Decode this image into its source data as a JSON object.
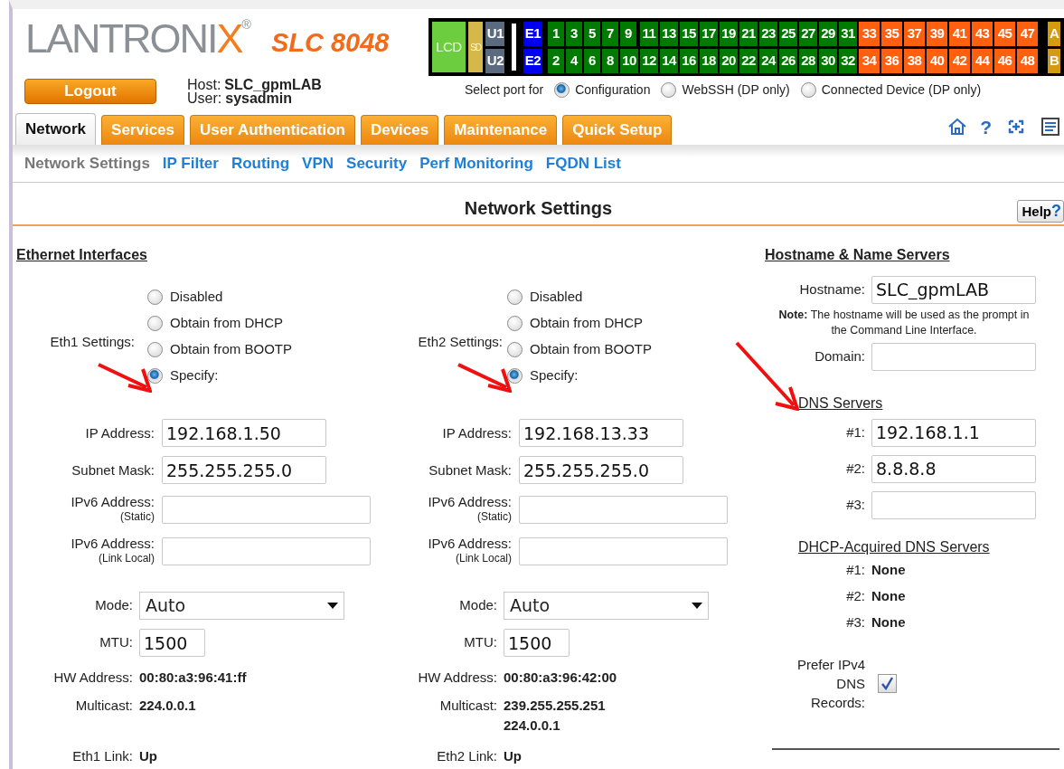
{
  "header": {
    "logo_text": "LANTRONI",
    "logo_accent": "X",
    "logo_mark": "®",
    "model": "SLC 8048",
    "logout": "Logout",
    "host_label": "Host:",
    "host": "SLC_gpmLAB",
    "user_label": "User:",
    "user": "sysadmin"
  },
  "port_panel": {
    "lcd": "LCD",
    "sd": "SD",
    "u_ports": [
      "U1",
      "U2"
    ],
    "e_ports": [
      "E1",
      "E2"
    ],
    "ports": [
      {
        "label": "1",
        "color": "#007a00"
      },
      {
        "label": "2",
        "color": "#007a00"
      },
      {
        "label": "3",
        "color": "#007a00"
      },
      {
        "label": "4",
        "color": "#007a00"
      },
      {
        "label": "5",
        "color": "#007a00"
      },
      {
        "label": "6",
        "color": "#007a00"
      },
      {
        "label": "7",
        "color": "#007a00"
      },
      {
        "label": "8",
        "color": "#007a00"
      },
      {
        "label": "9",
        "color": "#007a00"
      },
      {
        "label": "10",
        "color": "#007a00"
      },
      {
        "label": "11",
        "color": "#007a00"
      },
      {
        "label": "12",
        "color": "#007a00"
      },
      {
        "label": "13",
        "color": "#007a00"
      },
      {
        "label": "14",
        "color": "#007a00"
      },
      {
        "label": "15",
        "color": "#007a00"
      },
      {
        "label": "16",
        "color": "#007a00"
      },
      {
        "label": "17",
        "color": "#007a00"
      },
      {
        "label": "18",
        "color": "#007a00"
      },
      {
        "label": "19",
        "color": "#007a00"
      },
      {
        "label": "20",
        "color": "#007a00"
      },
      {
        "label": "21",
        "color": "#007a00"
      },
      {
        "label": "22",
        "color": "#007a00"
      },
      {
        "label": "23",
        "color": "#007a00"
      },
      {
        "label": "24",
        "color": "#007a00"
      },
      {
        "label": "25",
        "color": "#007a00"
      },
      {
        "label": "26",
        "color": "#007a00"
      },
      {
        "label": "27",
        "color": "#007a00"
      },
      {
        "label": "28",
        "color": "#007a00"
      },
      {
        "label": "29",
        "color": "#007a00"
      },
      {
        "label": "30",
        "color": "#007a00"
      },
      {
        "label": "31",
        "color": "#007a00"
      },
      {
        "label": "32",
        "color": "#007a00"
      },
      {
        "label": "33",
        "color": "#ff6010"
      },
      {
        "label": "34",
        "color": "#ff6010"
      },
      {
        "label": "35",
        "color": "#ff6010"
      },
      {
        "label": "36",
        "color": "#ff6010"
      },
      {
        "label": "37",
        "color": "#ff6010"
      },
      {
        "label": "38",
        "color": "#ff6010"
      },
      {
        "label": "39",
        "color": "#ff6010"
      },
      {
        "label": "40",
        "color": "#ff6010"
      },
      {
        "label": "41",
        "color": "#ff6010"
      },
      {
        "label": "42",
        "color": "#ff6010"
      },
      {
        "label": "43",
        "color": "#ff6010"
      },
      {
        "label": "44",
        "color": "#ff6010"
      },
      {
        "label": "45",
        "color": "#ff6010"
      },
      {
        "label": "46",
        "color": "#ff6010"
      },
      {
        "label": "47",
        "color": "#ff6010"
      },
      {
        "label": "48",
        "color": "#ff6010"
      }
    ],
    "aux_ports": [
      "A",
      "B"
    ]
  },
  "port_select": {
    "label": "Select port for",
    "options": [
      {
        "label": "Configuration",
        "selected": true
      },
      {
        "label": "WebSSH (DP only)",
        "selected": false
      },
      {
        "label": "Connected Device (DP only)",
        "selected": false
      }
    ]
  },
  "tabs": [
    {
      "label": "Network",
      "selected": true
    },
    {
      "label": "Services",
      "selected": false
    },
    {
      "label": "User Authentication",
      "selected": false
    },
    {
      "label": "Devices",
      "selected": false
    },
    {
      "label": "Maintenance",
      "selected": false
    },
    {
      "label": "Quick Setup",
      "selected": false
    }
  ],
  "toolbar": [
    {
      "kind": "home"
    },
    {
      "kind": "help",
      "text": "?"
    },
    {
      "kind": "expand"
    },
    {
      "kind": "document"
    }
  ],
  "subnav": [
    {
      "label": "Network Settings",
      "selected": true
    },
    {
      "label": "IP Filter",
      "selected": false
    },
    {
      "label": "Routing",
      "selected": false
    },
    {
      "label": "VPN",
      "selected": false
    },
    {
      "label": "Security",
      "selected": false
    },
    {
      "label": "Perf Monitoring",
      "selected": false
    },
    {
      "label": "FQDN List",
      "selected": false
    }
  ],
  "page_title": "Network Settings",
  "help_button": {
    "label": "Help",
    "glyph": "?"
  },
  "ethernet": {
    "heading": "Ethernet Interfaces",
    "interfaces": [
      {
        "settings_label": "Eth1 Settings:",
        "options": [
          {
            "label": "Disabled",
            "selected": false
          },
          {
            "label": "Obtain from DHCP",
            "selected": false
          },
          {
            "label": "Obtain from BOOTP",
            "selected": false
          },
          {
            "label": "Specify:",
            "selected": true
          }
        ],
        "fields": [
          {
            "label": "IP Address:",
            "value": "192.168.1.50",
            "kind": "short"
          },
          {
            "label": "Subnet Mask:",
            "value": "255.255.255.0",
            "kind": "short"
          },
          {
            "label": "IPv6 Address:",
            "sublabel": "(Static)",
            "kind": "long"
          },
          {
            "label": "IPv6 Address:",
            "sublabel": "(Link Local)",
            "kind": "long"
          }
        ],
        "mode": {
          "label": "Mode:",
          "value": "Auto"
        },
        "mtu": {
          "label": "MTU:",
          "value": "1500"
        },
        "info": [
          {
            "label": "HW Address:",
            "values": [
              "00:80:a3:96:41:ff"
            ]
          },
          {
            "label": "Multicast:",
            "values": [
              "224.0.0.1"
            ]
          },
          {
            "label": "Eth1 Link:",
            "values": [
              "Up"
            ]
          }
        ]
      },
      {
        "settings_label": "Eth2 Settings:",
        "options": [
          {
            "label": "Disabled",
            "selected": false
          },
          {
            "label": "Obtain from DHCP",
            "selected": false
          },
          {
            "label": "Obtain from BOOTP",
            "selected": false
          },
          {
            "label": "Specify:",
            "selected": true
          }
        ],
        "fields": [
          {
            "label": "IP Address:",
            "value": "192.168.13.33",
            "kind": "short"
          },
          {
            "label": "Subnet Mask:",
            "value": "255.255.255.0",
            "kind": "short"
          },
          {
            "label": "IPv6 Address:",
            "sublabel": "(Static)",
            "kind": "long"
          },
          {
            "label": "IPv6 Address:",
            "sublabel": "(Link Local)",
            "kind": "long"
          }
        ],
        "mode": {
          "label": "Mode:",
          "value": "Auto"
        },
        "mtu": {
          "label": "MTU:",
          "value": "1500"
        },
        "info": [
          {
            "label": "HW Address:",
            "values": [
              "00:80:a3:96:42:00"
            ]
          },
          {
            "label": "Multicast:",
            "values": [
              "239.255.255.251",
              "224.0.0.1"
            ]
          },
          {
            "label": "Eth2 Link:",
            "values": [
              "Up"
            ]
          }
        ]
      }
    ]
  },
  "name_servers": {
    "heading": "Hostname & Name Servers",
    "hostname": {
      "label": "Hostname:",
      "value": "SLC_gpmLAB"
    },
    "note": "**Note:** The hostname will be used as the prompt in the Command Line Interface.",
    "domain": {
      "label": "Domain:"
    },
    "dns_heading": "DNS Servers",
    "dns": [
      {
        "label": "#1:",
        "value": "192.168.1.1"
      },
      {
        "label": "#2:",
        "value": "8.8.8.8"
      },
      {
        "label": "#3:"
      }
    ],
    "dhcp_heading": "DHCP-Acquired DNS Servers",
    "dhcp_dns": [
      {
        "label": "#1:",
        "value": "None"
      },
      {
        "label": "#2:",
        "value": "None"
      },
      {
        "label": "#3:",
        "value": "None"
      }
    ],
    "prefer_ipv4": {
      "label": "Prefer IPv4 DNS Records:",
      "checked": true
    }
  },
  "callouts": [
    {
      "kind": "arrow"
    },
    {
      "kind": "arrow"
    },
    {
      "kind": "arrow"
    }
  ]
}
